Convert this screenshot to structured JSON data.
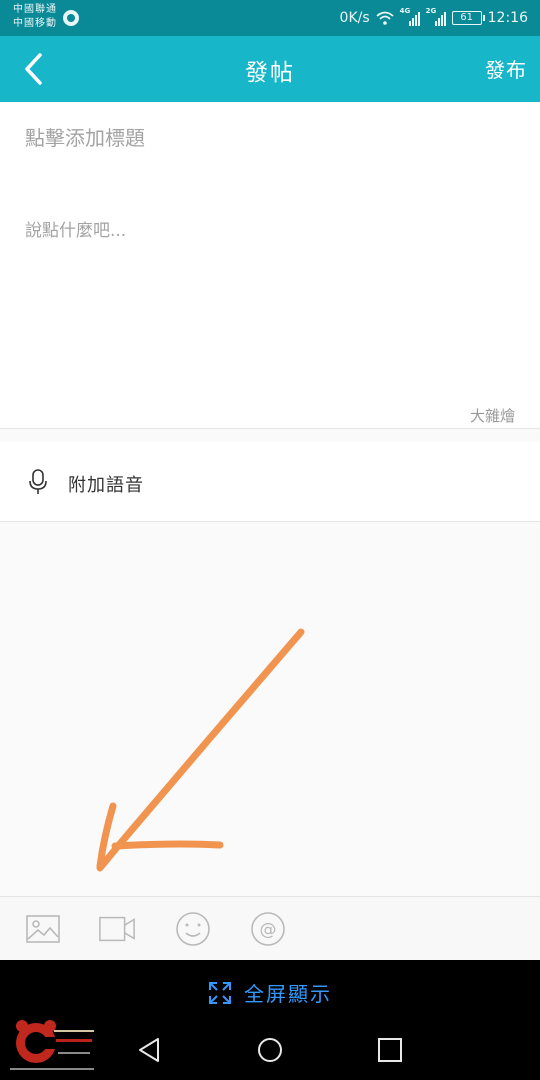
{
  "status_bar": {
    "carrier_1": "中國聯通",
    "carrier_2": "中國移動",
    "speed": "0K/s",
    "network_1": "4G",
    "network_2": "2G",
    "battery": "61",
    "time": "12:16"
  },
  "header": {
    "title": "發帖",
    "publish_label": "發布"
  },
  "editor": {
    "title_placeholder": "點擊添加標題",
    "content_placeholder": "說點什麼吧...",
    "category": "大雜燴"
  },
  "voice": {
    "label": "附加語音"
  },
  "toolbar": {
    "items": [
      "image-icon",
      "video-icon",
      "emoji-icon",
      "mention-icon"
    ]
  },
  "fullscreen": {
    "label": "全屏顯示"
  },
  "colors": {
    "status_bar": "#0a8a96",
    "header": "#17b6c8",
    "annotation": "#f0944f",
    "fullscreen_text": "#3399ff"
  }
}
